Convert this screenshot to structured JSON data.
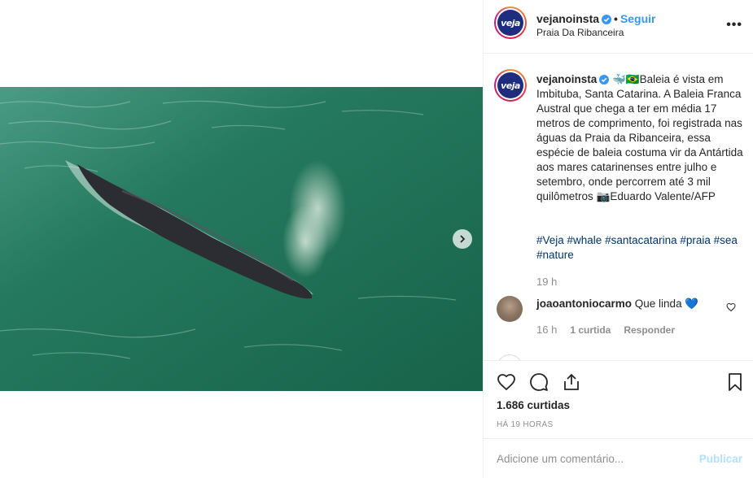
{
  "post": {
    "username": "vejanoinsta",
    "avatar_text": "veja",
    "follow_label": "Seguir",
    "separator": "•",
    "location": "Praia Da Ribanceira",
    "more_label": "•••"
  },
  "caption": {
    "username": "vejanoinsta",
    "text": "🐳🇧🇷Baleia é vista em Imbituba, Santa Catarina. A Baleia Franca Austral que chega a ter em média 17 metros de comprimento, foi registrada nas águas da Praia da Ribanceira, essa espécie de baleia costuma vir da Antártida aos mares catarinenses entre julho e setembro, onde percorrem até 3 mil quilômetros 📷Eduardo Valente/AFP",
    "hashtags": "#Veja #whale #santacatarina #praia #sea #nature",
    "time": "19 h"
  },
  "comment": {
    "username": "joaoantoniocarmo",
    "text": "Que linda 💙",
    "time": "16 h",
    "likes": "1 curtida",
    "reply": "Responder"
  },
  "actions": {
    "likes_count": "1.686 curtidas",
    "time_ago": "HÁ 19 HORAS"
  },
  "add_comment": {
    "placeholder": "Adicione um comentário...",
    "publish": "Publicar"
  },
  "colors": {
    "link": "#3897f0",
    "hashtag": "#003569",
    "muted": "#8e8e8e",
    "avatar_bg": "#1e2d7d",
    "water": "#1f7559"
  }
}
